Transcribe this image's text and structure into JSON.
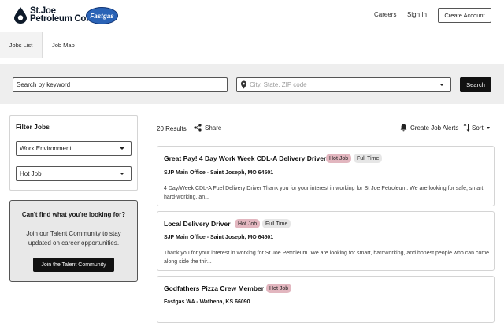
{
  "header": {
    "logo_line1": "St.Joe",
    "logo_line2": "Petroleum Co.",
    "fastgas_logo": "Fastgas",
    "nav": {
      "careers": "Careers",
      "sign_in": "Sign In",
      "create_account": "Create Account"
    }
  },
  "tabs": [
    {
      "label": "Jobs List",
      "active": true
    },
    {
      "label": "Job Map",
      "active": false
    }
  ],
  "search": {
    "keyword_value": "Search by keyword",
    "location_placeholder": "City, State, ZIP code",
    "button_label": "Search",
    "icons": [
      "map-pin-icon",
      "chevron-down-icon"
    ]
  },
  "filters": {
    "title": "Filter Jobs",
    "selects": [
      {
        "value": "Work Environment"
      },
      {
        "value": "Hot Job"
      }
    ]
  },
  "talent_community": {
    "title": "Can't find what you're looking for?",
    "text": "Join our Talent Community to stay updated on career opportunities.",
    "button_label": "Join the Talent Community"
  },
  "results": {
    "count_label": "20 Results",
    "share_label": "Share",
    "alerts_label": "Create Job Alerts",
    "sort_label": "Sort"
  },
  "jobs": [
    {
      "title": "Great Pay! 4 Day Work Week CDL-A Delivery Driver",
      "tags": [
        "Hot Job",
        "Full Time"
      ],
      "location": "SJP Main Office - Saint Joseph, MO 64501",
      "description": "4 Day/Week CDL-A Fuel Delivery Driver Thank you for your interest in working for St Joe Petroleum. We are looking for safe, smart, hard-working, an..."
    },
    {
      "title": "Local Delivery Driver",
      "tags": [
        "Hot Job",
        "Full Time"
      ],
      "location": "SJP Main Office - Saint Joseph, MO 64501",
      "description": "Thank you for your interest in working for St Joe Petroleum. We are looking for smart, hardworking, and honest people who can come along side the thir..."
    },
    {
      "title": "Godfathers Pizza Crew Member",
      "tags": [
        "Hot Job"
      ],
      "location": "Fastgas WA - Wathena, KS 66090",
      "description": ""
    }
  ],
  "colors": {
    "hot_tag": "#e2b6bf",
    "full_tag": "#e6e6e6",
    "primary_button": "#111111",
    "band": "#eeeeee"
  }
}
